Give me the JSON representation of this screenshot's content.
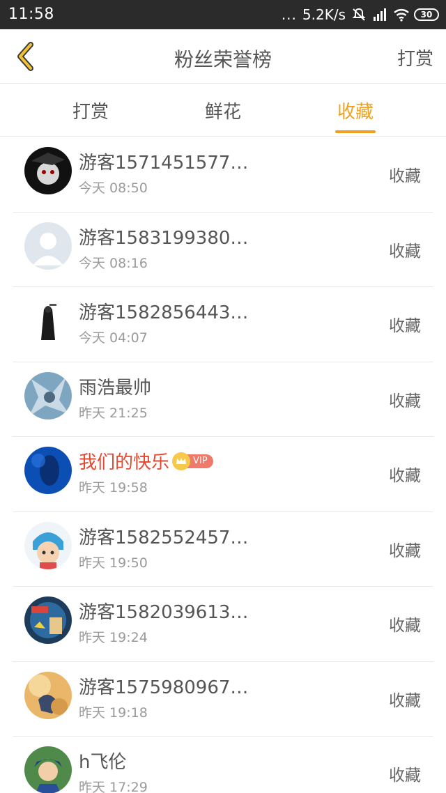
{
  "status_bar": {
    "time": "11:58",
    "dots": "...",
    "net_speed": "5.2K/s",
    "battery": "30"
  },
  "header": {
    "title": "粉丝荣誉榜",
    "right_link": "打赏",
    "back_icon": "chevron-left-icon",
    "accent": "#f0a01e"
  },
  "tabs": [
    {
      "label": "打赏",
      "active": false
    },
    {
      "label": "鲜花",
      "active": false
    },
    {
      "label": "收藏",
      "active": true
    }
  ],
  "fans": [
    {
      "name": "游客1571451577…",
      "time": "今天 08:50",
      "action": "收藏",
      "vip": false
    },
    {
      "name": "游客1583199380…",
      "time": "今天 08:16",
      "action": "收藏",
      "vip": false
    },
    {
      "name": "游客1582856443…",
      "time": "今天 04:07",
      "action": "收藏",
      "vip": false
    },
    {
      "name": "雨浩最帅",
      "time": "昨天 21:25",
      "action": "收藏",
      "vip": false
    },
    {
      "name": "我们的快乐",
      "time": "昨天 19:58",
      "action": "收藏",
      "vip": true,
      "vip_label": "VIP"
    },
    {
      "name": "游客1582552457…",
      "time": "昨天 19:50",
      "action": "收藏",
      "vip": false
    },
    {
      "name": "游客1582039613…",
      "time": "昨天 19:24",
      "action": "收藏",
      "vip": false
    },
    {
      "name": "游客1575980967…",
      "time": "昨天 19:18",
      "action": "收藏",
      "vip": false
    },
    {
      "name": "h飞伦",
      "time": "昨天 17:29",
      "action": "收藏",
      "vip": false
    }
  ],
  "colors": {
    "status_bar_bg": "#2b2b2b",
    "vip_name": "#e2492f",
    "vip_tag": "#ef7a6a"
  }
}
